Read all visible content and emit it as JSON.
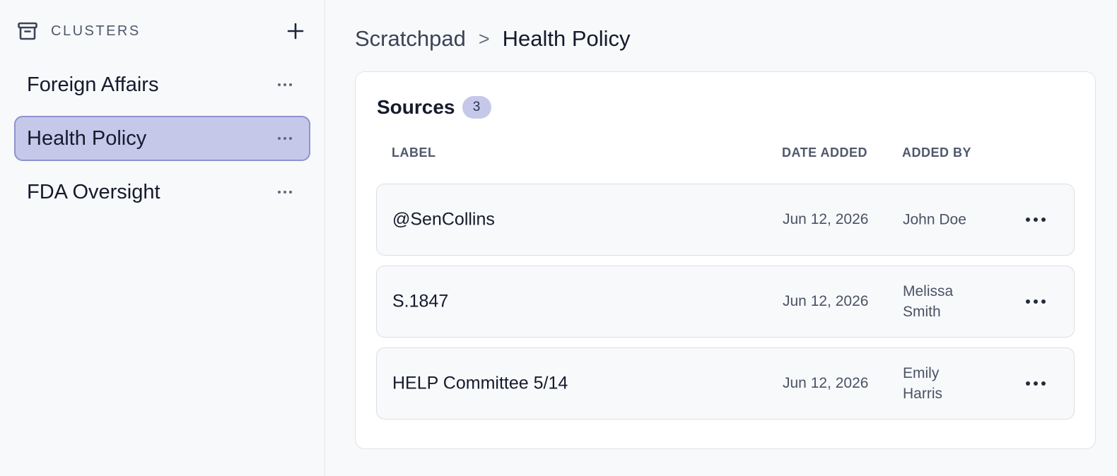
{
  "sidebar": {
    "title": "CLUSTERS",
    "add_icon": "plus-icon",
    "header_icon": "archive-icon",
    "items": [
      {
        "label": "Foreign Affairs",
        "active": false
      },
      {
        "label": "Health Policy",
        "active": true
      },
      {
        "label": "FDA Oversight",
        "active": false
      }
    ]
  },
  "breadcrumb": {
    "parent": "Scratchpad",
    "separator": ">",
    "current": "Health Policy"
  },
  "sources": {
    "title": "Sources",
    "count": "3",
    "columns": {
      "label": "LABEL",
      "date_added": "DATE ADDED",
      "added_by": "ADDED BY"
    },
    "rows": [
      {
        "label": "@SenCollins",
        "date_added": "Jun 12, 2026",
        "added_by": "John Doe"
      },
      {
        "label": "S.1847",
        "date_added": "Jun 12, 2026",
        "added_by": "Melissa Smith"
      },
      {
        "label": "HELP Committee 5/14",
        "date_added": "Jun 12, 2026",
        "added_by": "Emily Harris"
      }
    ]
  },
  "colors": {
    "accent_bg": "#c6c8ea",
    "accent_border": "#8e92cf",
    "text": "#151a2c"
  }
}
